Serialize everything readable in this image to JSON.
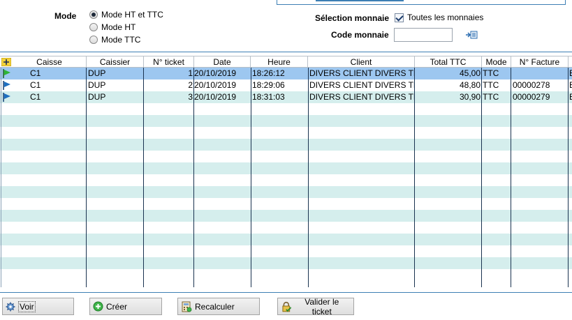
{
  "mode": {
    "label": "Mode",
    "options": [
      {
        "label": "Mode HT et TTC",
        "checked": true
      },
      {
        "label": "Mode HT",
        "checked": false
      },
      {
        "label": "Mode TTC",
        "checked": false
      }
    ]
  },
  "currency": {
    "selection_label": "Sélection monnaie",
    "all_label": "Toutes les monnaies",
    "all_checked": true,
    "code_label": "Code monnaie",
    "code_value": ""
  },
  "grid": {
    "columns": [
      "Caisse",
      "Caissier",
      "N° ticket",
      "Date",
      "Heure",
      "Client",
      "Total TTC",
      "Mode",
      "N° Facture"
    ],
    "rows": [
      {
        "caisse": "C1",
        "caissier": "DUP",
        "ticket": "1",
        "date": "20/10/2019",
        "heure": "18:26:12",
        "client": "DIVERS CLIENT DIVERS TR",
        "total": "45,00",
        "mode": "TTC",
        "facture": "",
        "extra": "E"
      },
      {
        "caisse": "C1",
        "caissier": "DUP",
        "ticket": "2",
        "date": "20/10/2019",
        "heure": "18:29:06",
        "client": "DIVERS CLIENT DIVERS TR",
        "total": "48,80",
        "mode": "TTC",
        "facture": "00000278",
        "extra": "E"
      },
      {
        "caisse": "C1",
        "caissier": "DUP",
        "ticket": "3",
        "date": "20/10/2019",
        "heure": "18:31:03",
        "client": "DIVERS CLIENT DIVERS TR",
        "total": "30,90",
        "mode": "TTC",
        "facture": "00000279",
        "extra": "E"
      }
    ],
    "selected_row": 0
  },
  "buttons": {
    "voir": "Voir",
    "creer": "Créer",
    "recalculer": "Recalculer",
    "valider": "Valider le ticket"
  },
  "colors": {
    "accent": "#3d7fb4",
    "row_alt": "#d5eeed",
    "row_selected": "#9dc7f0",
    "flag_selected": "#2db534",
    "flag_default": "#1e6fc0"
  }
}
